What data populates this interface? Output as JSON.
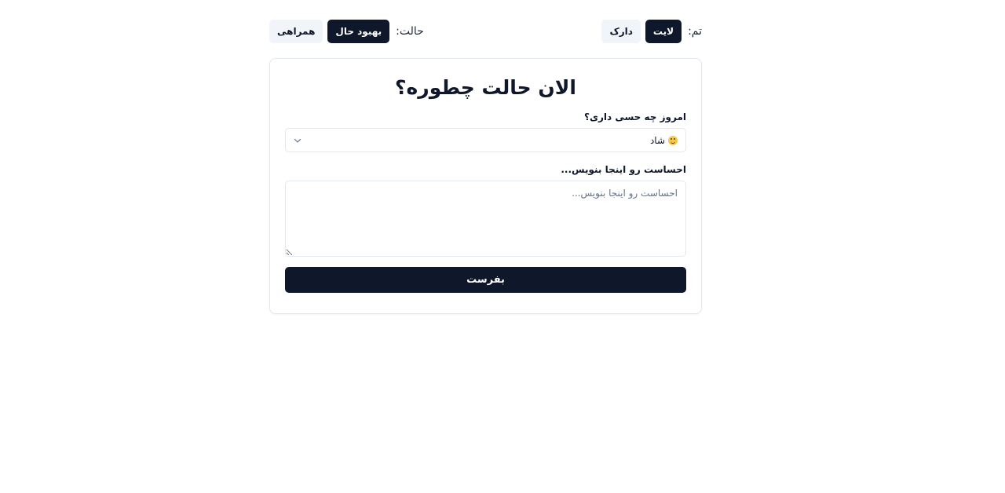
{
  "topbar": {
    "theme": {
      "label": "تم:",
      "options": [
        {
          "label": "لایت",
          "active": true
        },
        {
          "label": "دارک",
          "active": false
        }
      ]
    },
    "mode": {
      "label": "حالت:",
      "options": [
        {
          "label": "بهبود حال",
          "active": true
        },
        {
          "label": "همراهی",
          "active": false
        }
      ]
    }
  },
  "card": {
    "title": "الان حالت چطوره؟",
    "mood_label": "امروز چه حسی داری؟",
    "mood_select": {
      "value": "شاد",
      "icon": "smiling-face-emoji"
    },
    "feelings_label": "احساست رو اینجا بنویس...",
    "feelings_placeholder": "احساست رو اینجا بنویس...",
    "feelings_value": "",
    "submit_label": "بفرست"
  },
  "colors": {
    "primary": "#0f172a",
    "muted_bg": "#f1f5f9",
    "border": "#e2e8f0",
    "placeholder": "#64748b"
  }
}
